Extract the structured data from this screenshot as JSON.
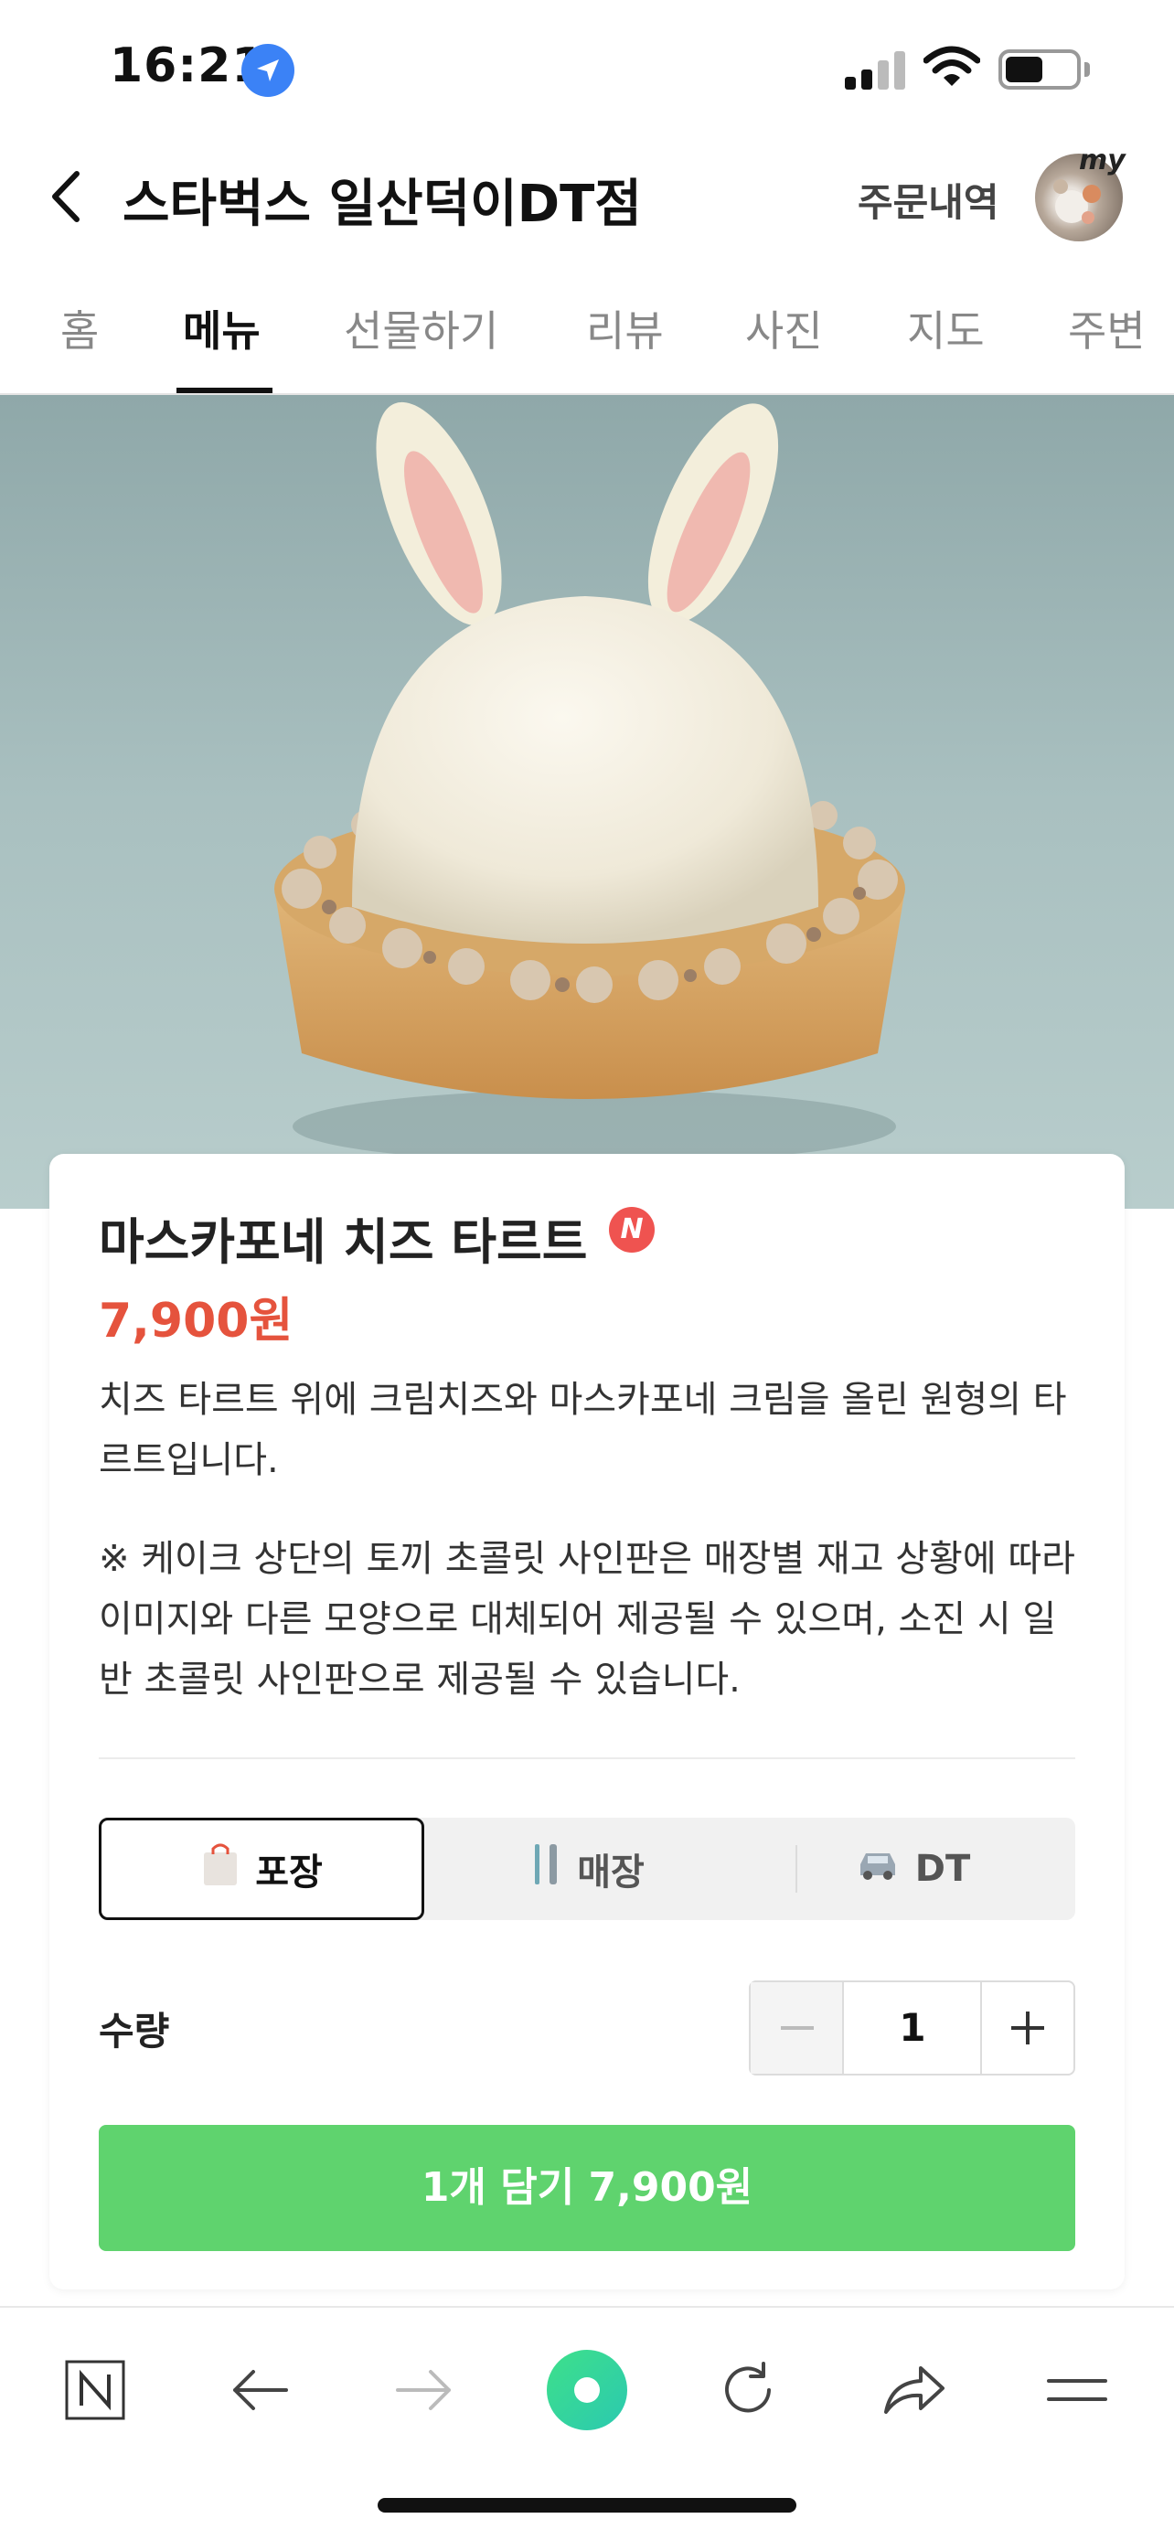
{
  "status_bar": {
    "time": "16:21"
  },
  "header": {
    "store_name": "스타벅스 일산덕이DT점",
    "order_history": "주문내역",
    "avatar_tag": "my"
  },
  "tabs": [
    {
      "label": "홈"
    },
    {
      "label": "메뉴",
      "active": true
    },
    {
      "label": "선물하기"
    },
    {
      "label": "리뷰"
    },
    {
      "label": "사진"
    },
    {
      "label": "지도"
    },
    {
      "label": "주변"
    }
  ],
  "product": {
    "name": "마스카포네 치즈 타르트",
    "badge": "N",
    "price": "7,900원",
    "description": "치즈 타르트 위에 크림치즈와 마스카포네 크림을 올린 원형의 타르트입니다.",
    "notice": "※ 케이크 상단의 토끼 초콜릿 사인판은 매장별 재고 상황에 따라 이미지와 다른 모양으로 대체되어 제공될 수 있으며, 소진 시 일반 초콜릿 사인판으로 제공될 수 있습니다."
  },
  "order_type": {
    "options": [
      {
        "label": "포장",
        "icon": "shopping-bag-icon",
        "selected": true
      },
      {
        "label": "매장",
        "icon": "fork-knife-icon",
        "selected": false
      },
      {
        "label": "DT",
        "icon": "car-icon",
        "selected": false
      }
    ]
  },
  "quantity": {
    "label": "수량",
    "value": "1"
  },
  "add_button": {
    "label": "1개 담기 7,900원"
  },
  "colors": {
    "accent_green": "#5fd36e",
    "price_red": "#e5533d",
    "badge_red": "#ef5350"
  },
  "toolbar": {
    "icons": [
      "naver-home-icon",
      "back-arrow-icon",
      "forward-arrow-icon",
      "green-dot-icon",
      "refresh-icon",
      "share-icon",
      "menu-icon"
    ]
  }
}
